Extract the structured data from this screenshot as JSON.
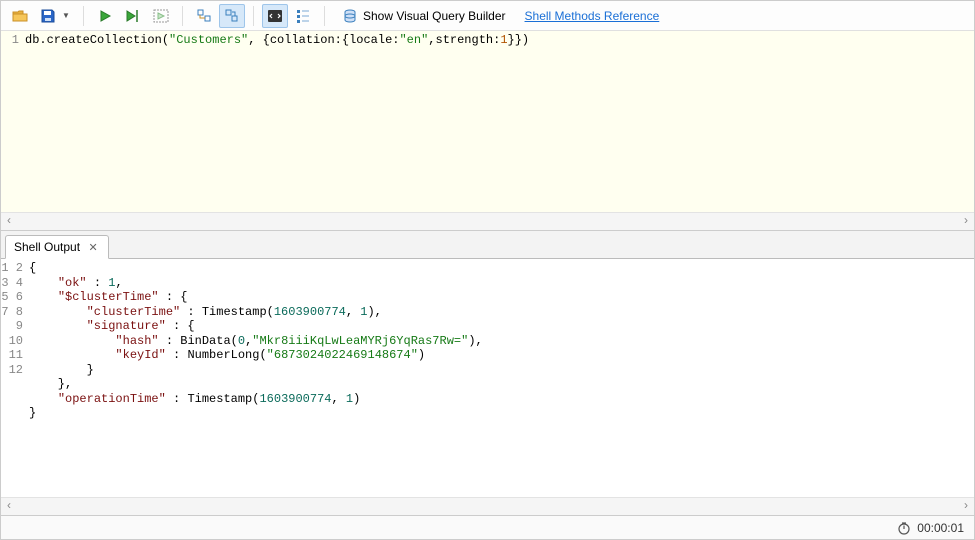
{
  "toolbar": {
    "show_vqb_label": "Show Visual Query Builder",
    "shell_ref_label": "Shell Methods Reference"
  },
  "editor": {
    "line_numbers": [
      "1"
    ],
    "code": {
      "prefix": "db.createCollection(",
      "arg1": "\"Customers\"",
      "mid": ", {collation:{locale:",
      "loc": "\"en\"",
      "mid2": ",strength:",
      "num": "1",
      "suffix": "}})"
    }
  },
  "tabs": [
    {
      "label": "Shell Output"
    }
  ],
  "output": {
    "line_numbers": [
      "1",
      "2",
      "3",
      "4",
      "5",
      "6",
      "7",
      "8",
      "9",
      "10",
      "11",
      "12"
    ],
    "l1": "{",
    "l2_key": "\"ok\"",
    "l2_sep": " : ",
    "l2_val": "1",
    "l2_end": ",",
    "l3_key": "\"$clusterTime\"",
    "l3_sep": " : {",
    "l4_key": "\"clusterTime\"",
    "l4_sep": " : Timestamp(",
    "l4_a": "1603900774",
    "l4_c": ", ",
    "l4_b": "1",
    "l4_end": "),",
    "l5_key": "\"signature\"",
    "l5_sep": " : {",
    "l6_key": "\"hash\"",
    "l6_sep": " : BinData(",
    "l6_a": "0",
    "l6_c": ",",
    "l6_s": "\"Mkr8iiiKqLwLeaMYRj6YqRas7Rw=\"",
    "l6_end": "),",
    "l7_key": "\"keyId\"",
    "l7_sep": " : NumberLong(",
    "l7_s": "\"6873024022469148674\"",
    "l7_end": ")",
    "l8": "        }",
    "l9": "    },",
    "l10_key": "\"operationTime\"",
    "l10_sep": " : Timestamp(",
    "l10_a": "1603900774",
    "l10_c": ", ",
    "l10_b": "1",
    "l10_end": ")",
    "l11": "}",
    "l12": ""
  },
  "status": {
    "elapsed": "00:00:01"
  }
}
